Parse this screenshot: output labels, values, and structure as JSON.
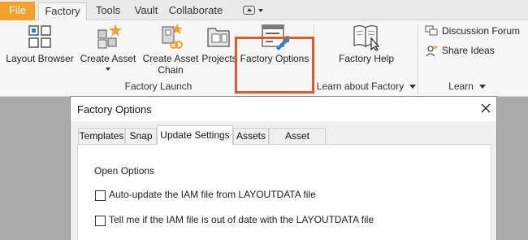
{
  "ribbon_tabs": {
    "file": "File",
    "factory": "Factory",
    "tools": "Tools",
    "vault": "Vault",
    "collaborate": "Collaborate"
  },
  "ribbon": {
    "layout_browser": "Layout Browser",
    "create_asset": "Create Asset",
    "create_asset_chain_1": "Create Asset",
    "create_asset_chain_2": "Chain",
    "projects": "Projects",
    "factory_options": "Factory Options",
    "factory_help": "Factory Help",
    "discussion_forum": "Discussion Forum",
    "share_ideas": "Share Ideas",
    "groups": {
      "factory_launch": "Factory Launch",
      "learn_about_factory": "Learn about Factory",
      "learn": "Learn"
    }
  },
  "dialog": {
    "title": "Factory Options",
    "tabs": [
      "Templates",
      "Snap",
      "Update Settings",
      "Assets",
      "Asset Builder"
    ],
    "active_tab": "Update Settings",
    "section_title": "Open Options",
    "options": [
      {
        "label": "Auto-update the IAM file from LAYOUTDATA file",
        "checked": false
      },
      {
        "label": "Tell me if the IAM file is out of date with the LAYOUTDATA file",
        "checked": false
      }
    ]
  },
  "colors": {
    "file_tab": "#f1a22c",
    "highlight_box": "#dc5a2c",
    "icon_blue": "#2f7fd6",
    "icon_orange": "#f0a030"
  }
}
